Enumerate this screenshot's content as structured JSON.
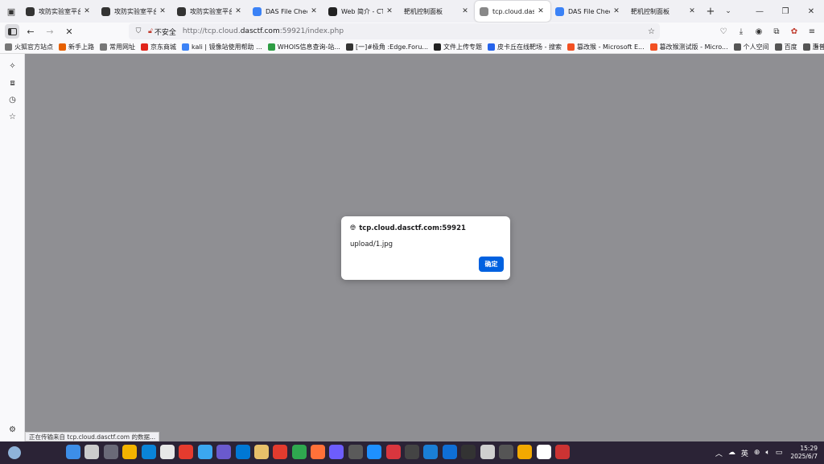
{
  "tabs": [
    {
      "label": "攻防实验室平台",
      "icon": "spy-icon",
      "color": "#333333"
    },
    {
      "label": "攻防实验室平台",
      "icon": "spy-icon",
      "color": "#333333"
    },
    {
      "label": "攻防实验室平台",
      "icon": "spy-icon",
      "color": "#333333"
    },
    {
      "label": "DAS File Checker",
      "icon": "globe-icon",
      "color": "#3b82f6"
    },
    {
      "label": "Web 简介 - CTF Wiki",
      "icon": "github-icon",
      "color": "#222222"
    },
    {
      "label": "靶机控制面板",
      "icon": "none",
      "color": "#f0f0f4"
    },
    {
      "label": "tcp.cloud.dasctf.com",
      "icon": "dot-icon",
      "color": "#888888",
      "active": true
    },
    {
      "label": "DAS File Checker",
      "icon": "globe-icon",
      "color": "#3b82f6"
    },
    {
      "label": "靶机控制面板",
      "icon": "none",
      "color": "#f0f0f4"
    }
  ],
  "nav": {
    "insecure_label": "不安全",
    "url_prefix": "http://tcp.cloud.",
    "url_host": "dasctf.com",
    "url_suffix": ":59921/index.php"
  },
  "bookmarks": [
    {
      "label": "火狐官方站点",
      "color": "#777777"
    },
    {
      "label": "新手上路",
      "color": "#e66000"
    },
    {
      "label": "常用网址",
      "color": "#777777"
    },
    {
      "label": "京东商城",
      "color": "#e1251b"
    },
    {
      "label": "kali | 镜像站使用帮助 ...",
      "color": "#3b82f6"
    },
    {
      "label": "WHOIS信息查询-站...",
      "color": "#2e9d44"
    },
    {
      "label": "[一]#极角 :Edge.Foru...",
      "color": "#333333"
    },
    {
      "label": "文件上传专题",
      "color": "#222222"
    },
    {
      "label": "皮卡丘在线靶场 - 搜索",
      "color": "#2563eb"
    },
    {
      "label": "篡改猴 - Microsoft E...",
      "color": "#f25022"
    },
    {
      "label": "篡改猴测试版 - Micro...",
      "color": "#f25022"
    },
    {
      "label": "个人空间",
      "color": "#555555"
    },
    {
      "label": "百度",
      "color": "#555555"
    },
    {
      "label": "惠普官网",
      "color": "#555555"
    }
  ],
  "dialog": {
    "title": "tcp.cloud.dasctf.com:59921",
    "message": "upload/1.jpg",
    "ok_label": "确定"
  },
  "status_text": "正在传输来自 tcp.cloud.dasctf.com 的数据...",
  "taskbar": {
    "icons": [
      "#3d8ee8",
      "#cccccc",
      "#6a6a78",
      "#f4b400",
      "#0a84d8",
      "#e7e7e7",
      "#e63b2e",
      "#3ba7f0",
      "#6a5acd",
      "#0078d4",
      "#e8c06a",
      "#e33b2e",
      "#2fa84f",
      "#ff7139",
      "#6d5dfc",
      "#5a5a5a",
      "#1e90ff",
      "#d9363e",
      "#444444",
      "#1a7fd6",
      "#0f6fd6",
      "#333333",
      "#cfcfcf",
      "#555555",
      "#f2a900",
      "#ffffff",
      "#cc3333"
    ],
    "lang": "英",
    "time": "15:29",
    "date": "2025/6/7"
  }
}
